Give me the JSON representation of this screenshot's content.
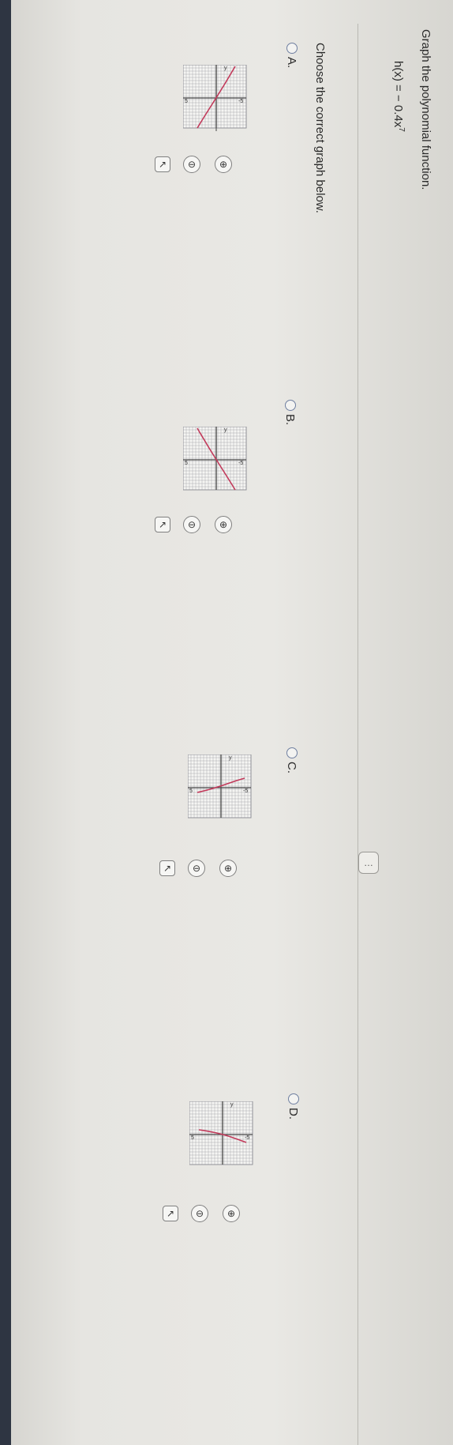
{
  "question": {
    "title": "Graph the polynomial function.",
    "function_lhs": "h(x) = − 0.4x",
    "function_exponent": "7",
    "prompt": "Choose the correct graph below."
  },
  "options": [
    {
      "id": "A",
      "label": "A.",
      "selected": false
    },
    {
      "id": "B",
      "label": "B.",
      "selected": false
    },
    {
      "id": "C",
      "label": "C.",
      "selected": false
    },
    {
      "id": "D",
      "label": "D.",
      "selected": false
    }
  ],
  "graph_labels": {
    "x_axis": "x",
    "y_axis": "y",
    "tick_pos": "5",
    "tick_neg": "-5"
  },
  "icons": [
    "zoom-in-icon",
    "zoom-out-icon",
    "open-external-icon"
  ],
  "more_button": "…",
  "colors": {
    "curve": "#c2395a",
    "grid": "#8f9097",
    "radio": "#6f7fa0"
  }
}
